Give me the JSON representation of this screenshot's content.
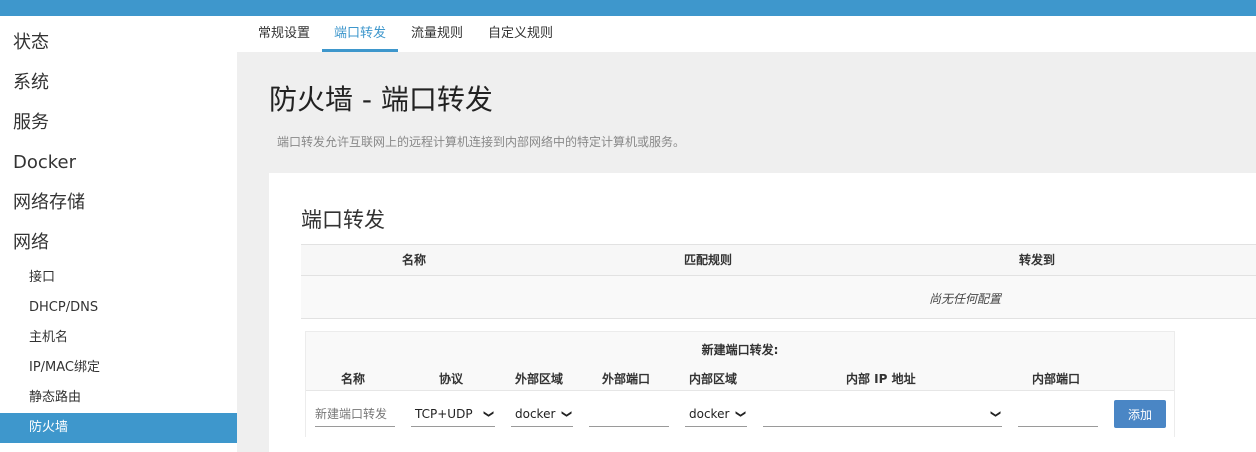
{
  "sidebar": {
    "main_items": [
      "状态",
      "系统",
      "服务",
      "Docker",
      "网络存储",
      "网络"
    ],
    "sub_items": [
      {
        "label": "接口"
      },
      {
        "label": "DHCP/DNS"
      },
      {
        "label": "主机名"
      },
      {
        "label": "IP/MAC绑定"
      },
      {
        "label": "静态路由"
      },
      {
        "label": "防火墙",
        "active": true
      }
    ]
  },
  "tabs": [
    {
      "label": "常规设置"
    },
    {
      "label": "端口转发",
      "active": true
    },
    {
      "label": "流量规则"
    },
    {
      "label": "自定义规则"
    }
  ],
  "page": {
    "title": "防火墙 - 端口转发",
    "description": "端口转发允许互联网上的远程计算机连接到内部网络中的特定计算机或服务。"
  },
  "section": {
    "title": "端口转发",
    "table_headers": [
      "名称",
      "匹配规则",
      "转发到"
    ],
    "empty_text": "尚无任何配置"
  },
  "new_forward": {
    "title": "新建端口转发:",
    "columns": [
      "名称",
      "协议",
      "外部区域",
      "外部端口",
      "内部区域",
      "内部 IP 地址",
      "内部端口"
    ],
    "name_placeholder": "新建端口转发",
    "protocol": "TCP+UDP",
    "external_zone": "docker",
    "external_port": "",
    "internal_zone": "docker",
    "internal_ip": "",
    "internal_port": "",
    "add_label": "添加"
  },
  "colors": {
    "accent": "#3e97cc",
    "button": "#4a86c5"
  }
}
